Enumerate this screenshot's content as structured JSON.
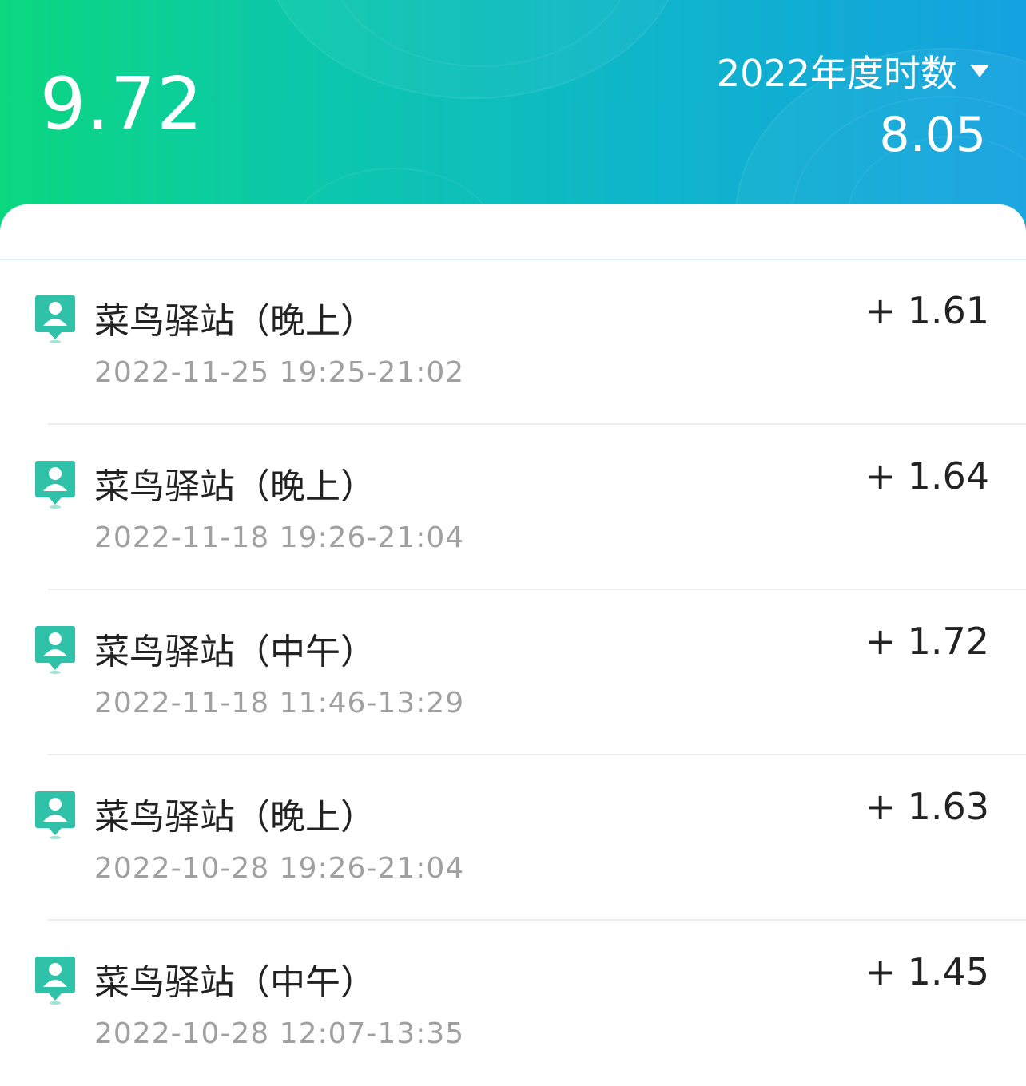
{
  "header": {
    "total_hours": "9.72",
    "year_selector_label": "2022年度时数",
    "year_hours": "8.05"
  },
  "colors": {
    "gradient_start": "#0bd77f",
    "gradient_end": "#14a2e0",
    "pin_icon": "#2fc2a9"
  },
  "records": [
    {
      "title": "菜鸟驿站（晚上）",
      "time": "2022-11-25 19:25-21:02",
      "value": "+ 1.61"
    },
    {
      "title": "菜鸟驿站（晚上）",
      "time": "2022-11-18 19:26-21:04",
      "value": "+ 1.64"
    },
    {
      "title": "菜鸟驿站（中午）",
      "time": "2022-11-18 11:46-13:29",
      "value": "+ 1.72"
    },
    {
      "title": "菜鸟驿站（晚上）",
      "time": "2022-10-28 19:26-21:04",
      "value": "+ 1.63"
    },
    {
      "title": "菜鸟驿站（中午）",
      "time": "2022-10-28 12:07-13:35",
      "value": "+ 1.45"
    }
  ],
  "icons": {
    "record_icon": "location-person-pin-icon",
    "dropdown_icon": "caret-down-icon"
  }
}
